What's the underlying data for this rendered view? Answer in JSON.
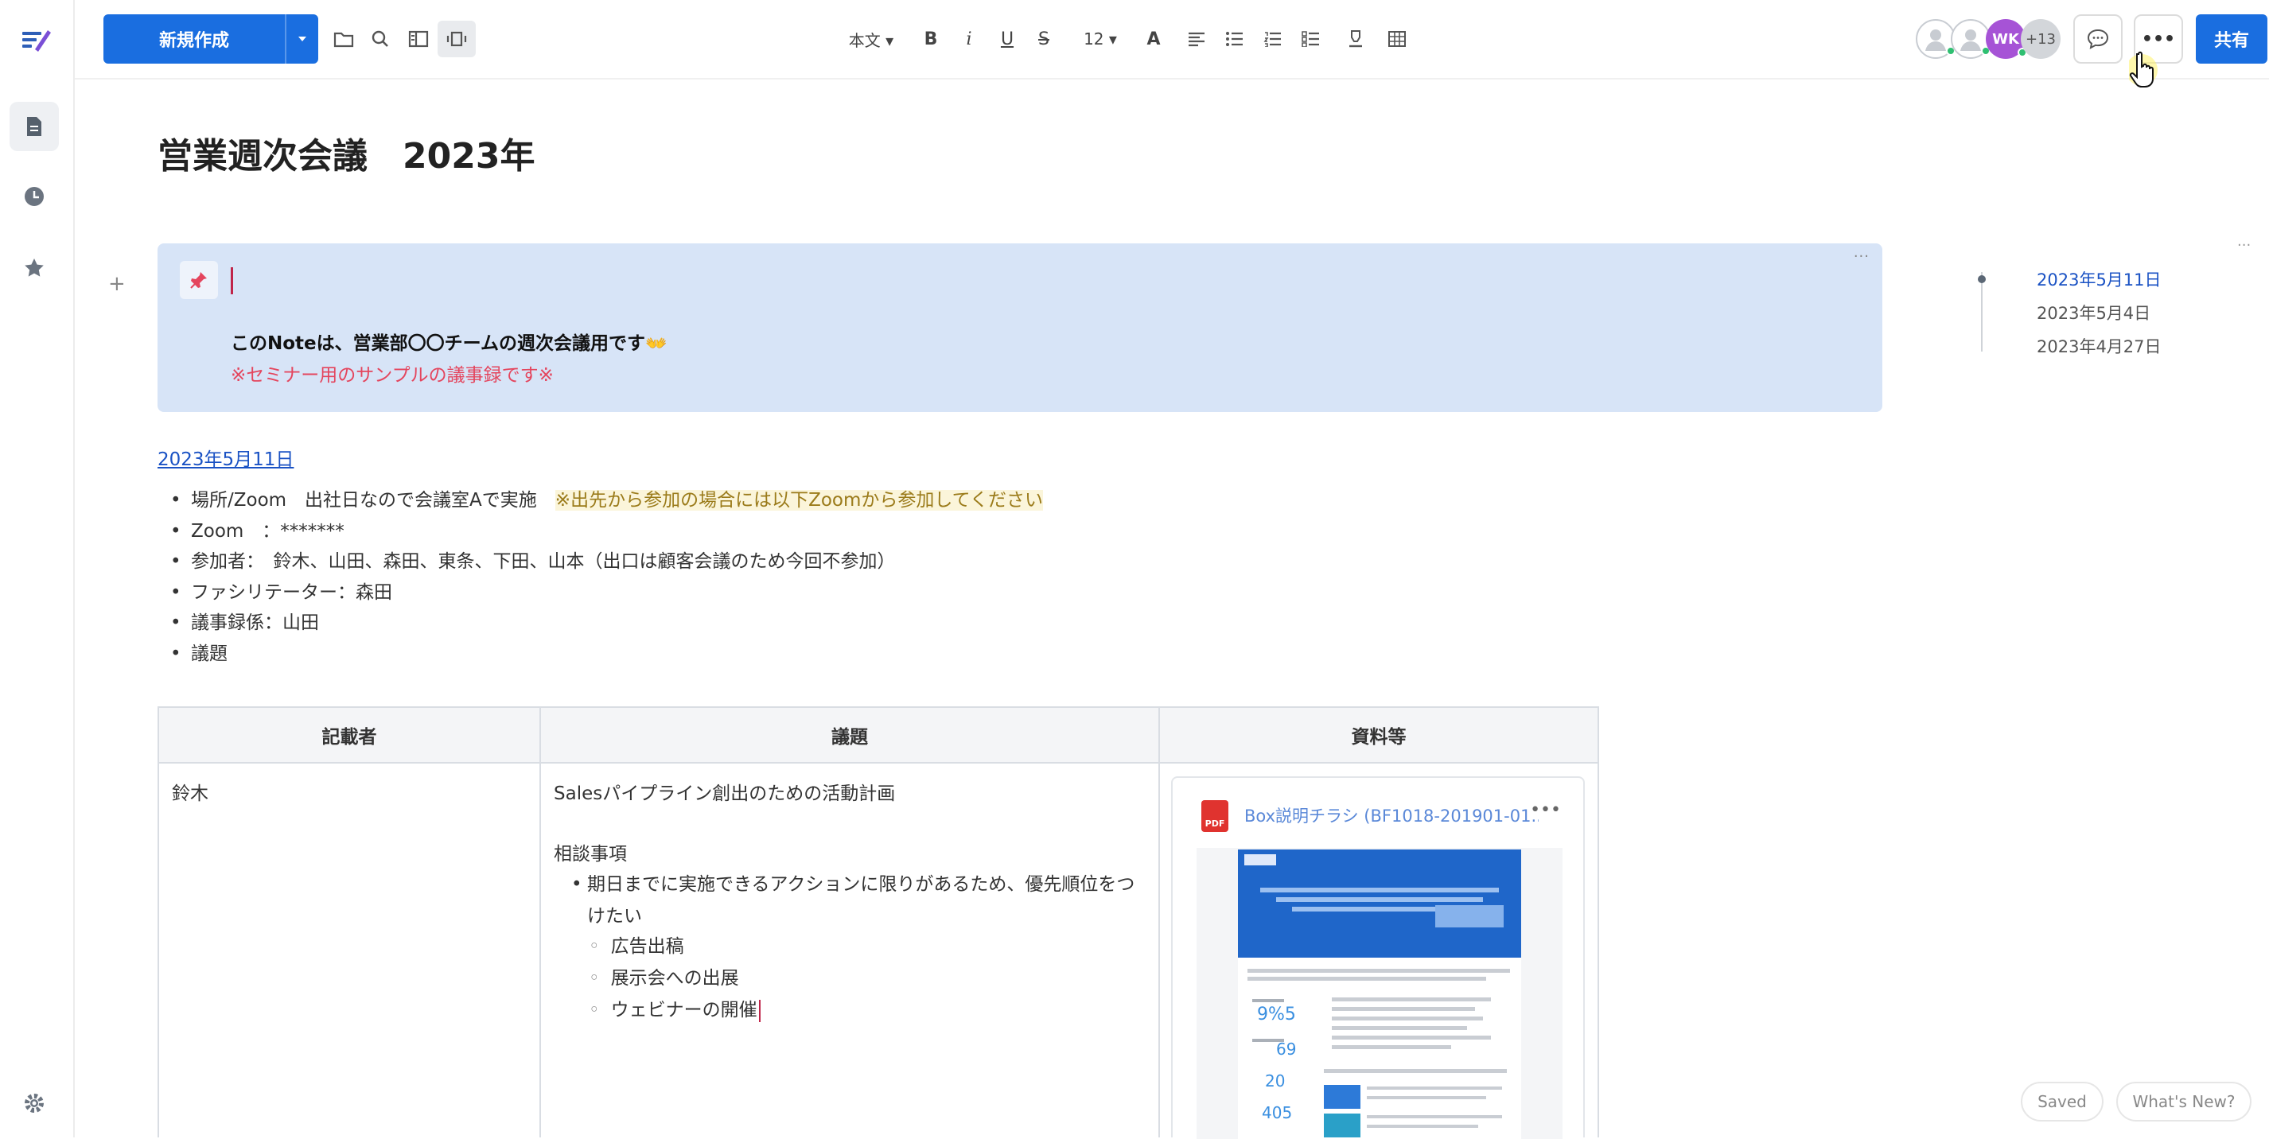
{
  "toolbar": {
    "new_button_label": "新規作成",
    "text_style": "本文 ▾",
    "bold": "B",
    "italic": "i",
    "underline": "U",
    "strike": "S",
    "font_size": "12 ▾",
    "font_color": "A",
    "avatar_initials": "WK",
    "avatar_extra": "+13",
    "share_label": "共有",
    "more": "•••"
  },
  "document": {
    "title": "営業週次会議　2023年",
    "callout": {
      "line1": "このNoteは、営業部〇〇チームの週次会議用です",
      "line1_emoji": "👐",
      "line2": "※セミナー用のサンプルの議事録です※"
    },
    "section_date": "2023年5月11日",
    "bullets": [
      {
        "text": "場所/Zoom　出社日なので会議室Aで実施　",
        "highlight": "※出先から参加の場合には以下Zoomから参加してください"
      },
      {
        "text": "Zoom　：*******",
        "highlight": ""
      },
      {
        "text": "参加者：　鈴木、山田、森田、東条、下田、山本（出口は顧客会議のため今回不参加）",
        "highlight": ""
      },
      {
        "text": "ファシリテーター：森田",
        "highlight": ""
      },
      {
        "text": "議事録係：山田",
        "highlight": ""
      },
      {
        "text": "議題",
        "highlight": ""
      }
    ],
    "table": {
      "headers": [
        "記載者",
        "議題",
        "資料等"
      ],
      "row": {
        "author": "鈴木",
        "topic_title": "Salesパイプライン創出のための活動計画",
        "consult_heading": "相談事項",
        "consult_item": "期日までに実施できるアクションに限りがあるため、優先順位をつけたい",
        "consult_subitems": [
          "広告出稿",
          "展示会への出展",
          "ウェビナーの開催"
        ],
        "file_name": "Box説明チラシ (BF1018-201901-01..."
      }
    }
  },
  "timeline": {
    "items": [
      "2023年5月11日",
      "2023年5月4日",
      "2023年4月27日"
    ]
  },
  "footer": {
    "saved": "Saved",
    "whats_new": "What's New?"
  },
  "icons": {
    "app_logo": "notes-pen-icon",
    "sidebar": [
      "document-icon",
      "clock-icon",
      "star-icon",
      "gear-icon"
    ]
  },
  "colors": {
    "accent": "#1a6ee0",
    "callout_bg": "#d7e4f7",
    "link": "#1a52c4",
    "warning_red": "#e4455d"
  }
}
